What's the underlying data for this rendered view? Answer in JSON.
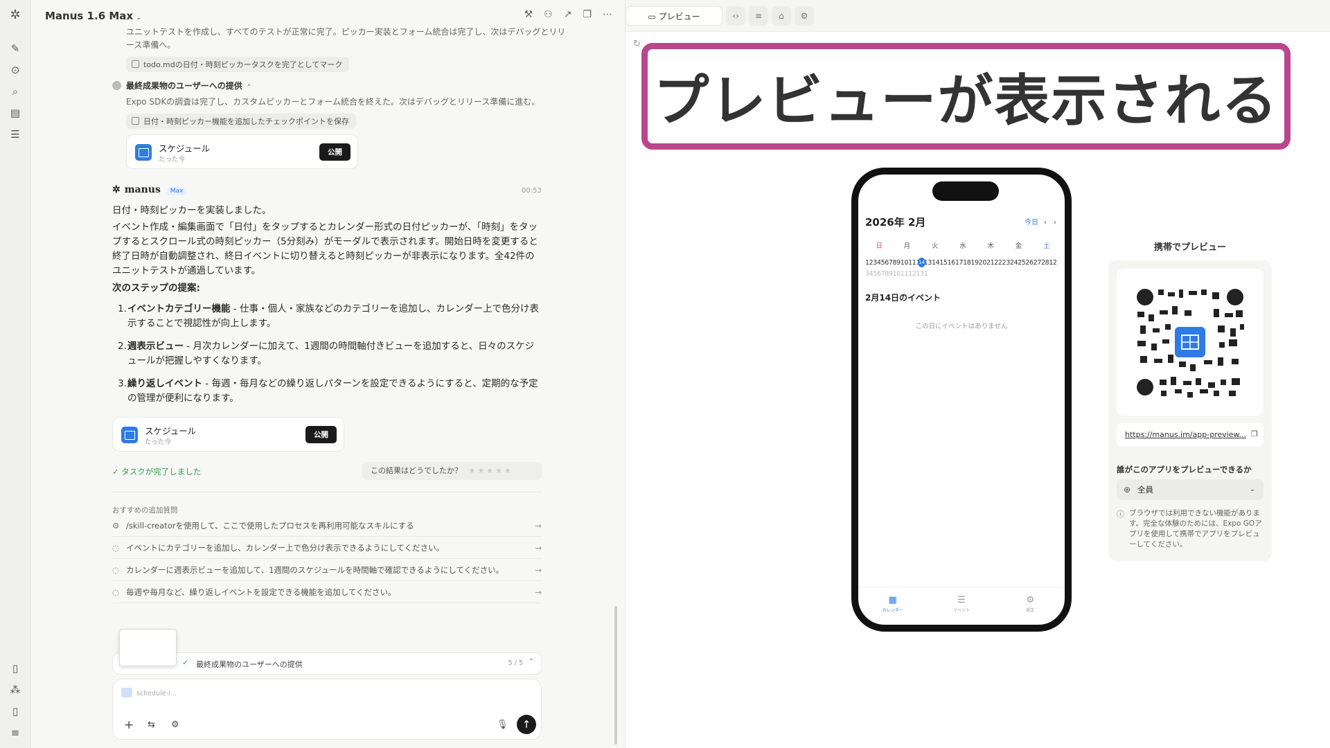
{
  "header": {
    "model": "Manus 1.6 Max"
  },
  "chat": {
    "prev_text": "ユニットテストを作成し、すべてのテストが正常に完了。ピッカー実装とフォーム統合は完了し、次はデバッグとリリース準備へ。",
    "chip1": "todo.mdの日付・時刻ピッカータスクを完了としてマーク",
    "step_title": "最終成果物のユーザーへの提供",
    "step_desc": "Expo SDKの調査は完了し、カスタムピッカーとフォーム統合を終えた。次はデバッグとリリース準備に進む。",
    "chip2": "日付・時刻ピッカー機能を追加したチェックポイントを保存",
    "card1": {
      "title": "スケジュール",
      "sub": "たった今",
      "button": "公開"
    },
    "agent_name": "manus",
    "agent_badge": "Max",
    "time": "00:53",
    "msg_line1": "日付・時刻ピッカーを実装しました。",
    "msg_para": "イベント作成・編集画面で「日付」をタップするとカレンダー形式の日付ピッカーが、「時刻」をタップするとスクロール式の時刻ピッカー（5分刻み）がモーダルで表示されます。開始日時を変更すると終了日時が自動調整され、終日イベントに切り替えると時刻ピッカーが非表示になります。全42件のユニットテストが通過しています。",
    "next_heading": "次のステップの提案:",
    "steps": [
      {
        "num": "1.",
        "bold": "イベントカテゴリー機能",
        "text": " - 仕事・個人・家族などのカテゴリーを追加し、カレンダー上で色分け表示することで視認性が向上します。"
      },
      {
        "num": "2.",
        "bold": "週表示ビュー",
        "text": " - 月次カレンダーに加えて、1週間の時間軸付きビューを追加すると、日々のスケジュールが把握しやすくなります。"
      },
      {
        "num": "3.",
        "bold": "繰り返しイベント",
        "text": " - 毎週・毎月などの繰り返しパターンを設定できるようにすると、定期的な予定の管理が便利になります。"
      }
    ],
    "card2": {
      "title": "スケジュール",
      "sub": "たった今",
      "button": "公開"
    },
    "done": "タスクが完了しました",
    "rating_q": "この結果はどうでしたか？",
    "followup_heading": "おすすめの追加質問",
    "followups": [
      "/skill-creatorを使用して、ここで使用したプロセスを再利用可能なスキルにする",
      "イベントにカテゴリーを追加し、カレンダー上で色分け表示できるようにしてください。",
      "カレンダーに週表示ビューを追加して、1週間のスケジュールを時間軸で確認できるようにしてください。",
      "毎週や毎月など、繰り返しイベントを設定できる機能を追加してください。"
    ],
    "task_bar": "最終成果物のユーザーへの提供",
    "task_progress": "5 / 5",
    "attachment": "schedule-i..."
  },
  "preview": {
    "tab_label": "プレビュー",
    "banner": "プレビューが表示される",
    "phone": {
      "month": "2026年 2月",
      "today": "今日",
      "weekdays": [
        "日",
        "月",
        "火",
        "水",
        "木",
        "金",
        "土"
      ],
      "days_row1": "1234567891011121314151617181920212223242526272812",
      "days_row2": "3456789101112131",
      "selected_day": "14",
      "events_heading": "2月14日のイベント",
      "empty": "この日にイベントはありません",
      "tabs": [
        "カレンダー",
        "イベント",
        "設定"
      ]
    },
    "mobile_title": "携帯でプレビュー",
    "url": "https://manus.im/app-preview...",
    "who_title": "誰がこのアプリをプレビューできるか",
    "who_value": "全員",
    "note": "ブラウザでは利用できない機能があります。完全な体験のためには、Expo GOアプリを使用して携帯でアプリをプレビューしてください。"
  }
}
